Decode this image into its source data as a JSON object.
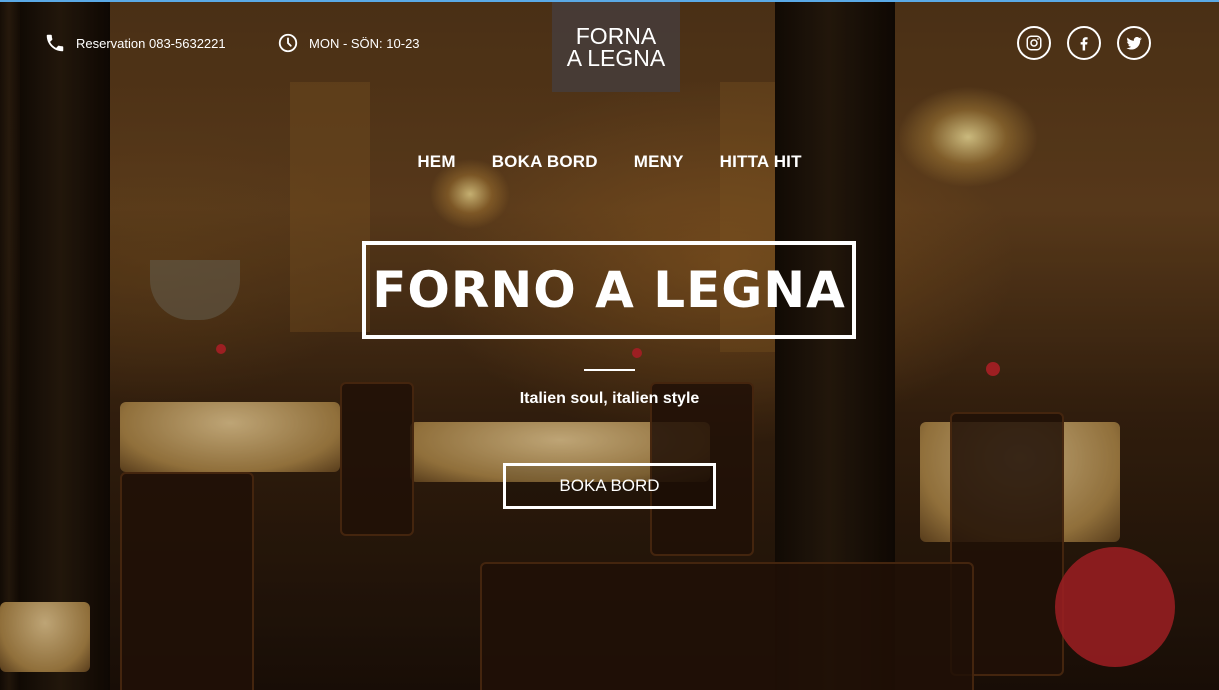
{
  "header": {
    "phone": "Reservation 083-5632221",
    "hours": "MON - SÖN: 10-23",
    "logo_line1": "FORNA",
    "logo_line2": "A LEGNA",
    "social": [
      "instagram-icon",
      "facebook-icon",
      "twitter-icon"
    ]
  },
  "nav": {
    "items": [
      "HEM",
      "BOKA BORD",
      "MENY",
      "HITTA HIT"
    ]
  },
  "hero": {
    "title": "FORNO A LEGNA",
    "tagline": "Italien soul, italien style",
    "cta": "BOKA BORD"
  },
  "colors": {
    "accent_top_border": "#5aa9e6",
    "logo_bg": "#463c38",
    "text": "#ffffff"
  }
}
